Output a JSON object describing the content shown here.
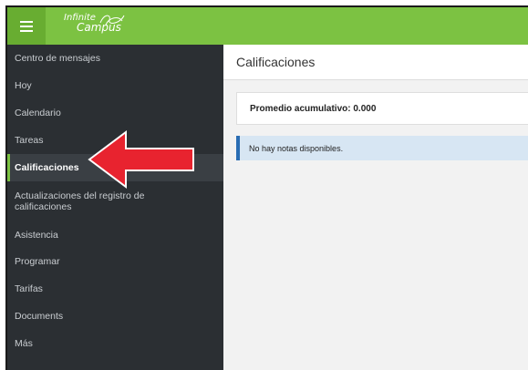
{
  "header": {
    "logo_line1": "Infinite",
    "logo_line2": "Campus"
  },
  "sidebar": {
    "items": [
      {
        "label": "Centro de mensajes"
      },
      {
        "label": "Hoy"
      },
      {
        "label": "Calendario"
      },
      {
        "label": "Tareas"
      },
      {
        "label": "Calificaciones",
        "active": true
      },
      {
        "label": "Actualizaciones del registro de calificaciones"
      },
      {
        "label": "Asistencia"
      },
      {
        "label": "Programar"
      },
      {
        "label": "Tarifas"
      },
      {
        "label": "Documents"
      },
      {
        "label": "Más"
      }
    ]
  },
  "main": {
    "title": "Calificaciones",
    "summary": "Promedio acumulativo: 0.000",
    "info_message": "No hay notas disponibles."
  },
  "colors": {
    "brand_green": "#7cc242",
    "sidebar_bg": "#2b2f33",
    "arrow_red": "#e8232f",
    "info_accent": "#2a6db3"
  }
}
